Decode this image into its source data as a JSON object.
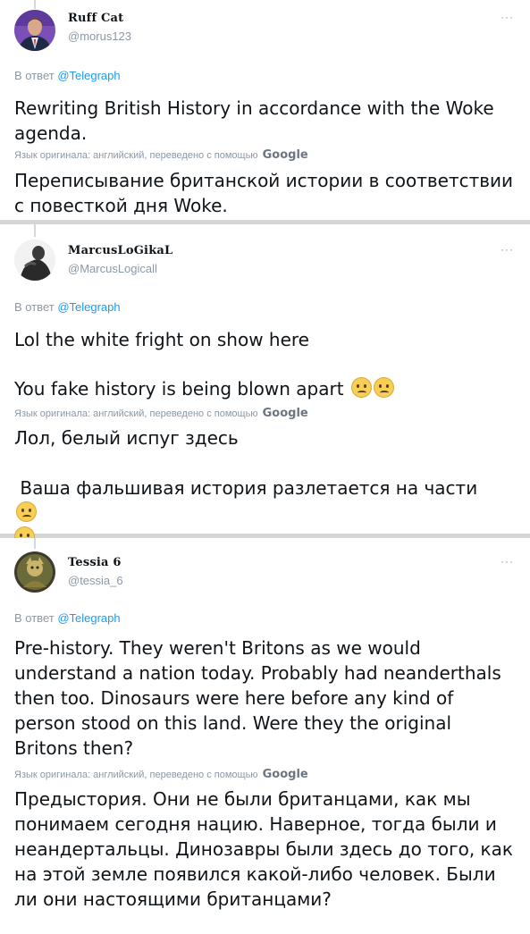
{
  "translation_note": "Язык оригинала: английский, переведено с помощью",
  "google_label": "Google",
  "reply_prefix": "В ответ",
  "more_label": "···",
  "tweets": [
    {
      "name": "Ruff Cat",
      "handle": "@morus123",
      "reply_to": "@Telegraph",
      "text": "Rewriting British History in accordance with the Woke agenda.",
      "translation": "Переписывание британской истории в соответствии с повесткой дня Woke."
    },
    {
      "name": "MarcusLoGikaL",
      "handle": "@MarcusLogicall",
      "reply_to": "@Telegraph",
      "text_line1": "Lol the white fright on show here",
      "text_line2": "You fake history is being blown apart",
      "translation_line1": "Лол, белый испуг здесь",
      "translation_line2": "Ваша фальшивая история разлетается на части"
    },
    {
      "name": "Tessia 6",
      "handle": "@tessia_6",
      "reply_to": "@Telegraph",
      "text": "Pre-history. They weren't Britons as we would understand a nation today. Probably had neanderthals then too. Dinosaurs were here before any kind of person stood on this land. Were they the original Britons then?",
      "translation": "Предыстория. Они не были британцами, как мы понимаем сегодня нацию. Наверное, тогда были и неандертальцы. Динозавры были здесь до того, как на этой земле появился какой-либо человек. Были ли они настоящими британцами?"
    }
  ],
  "emoji_name": "woozy-face-emoji"
}
